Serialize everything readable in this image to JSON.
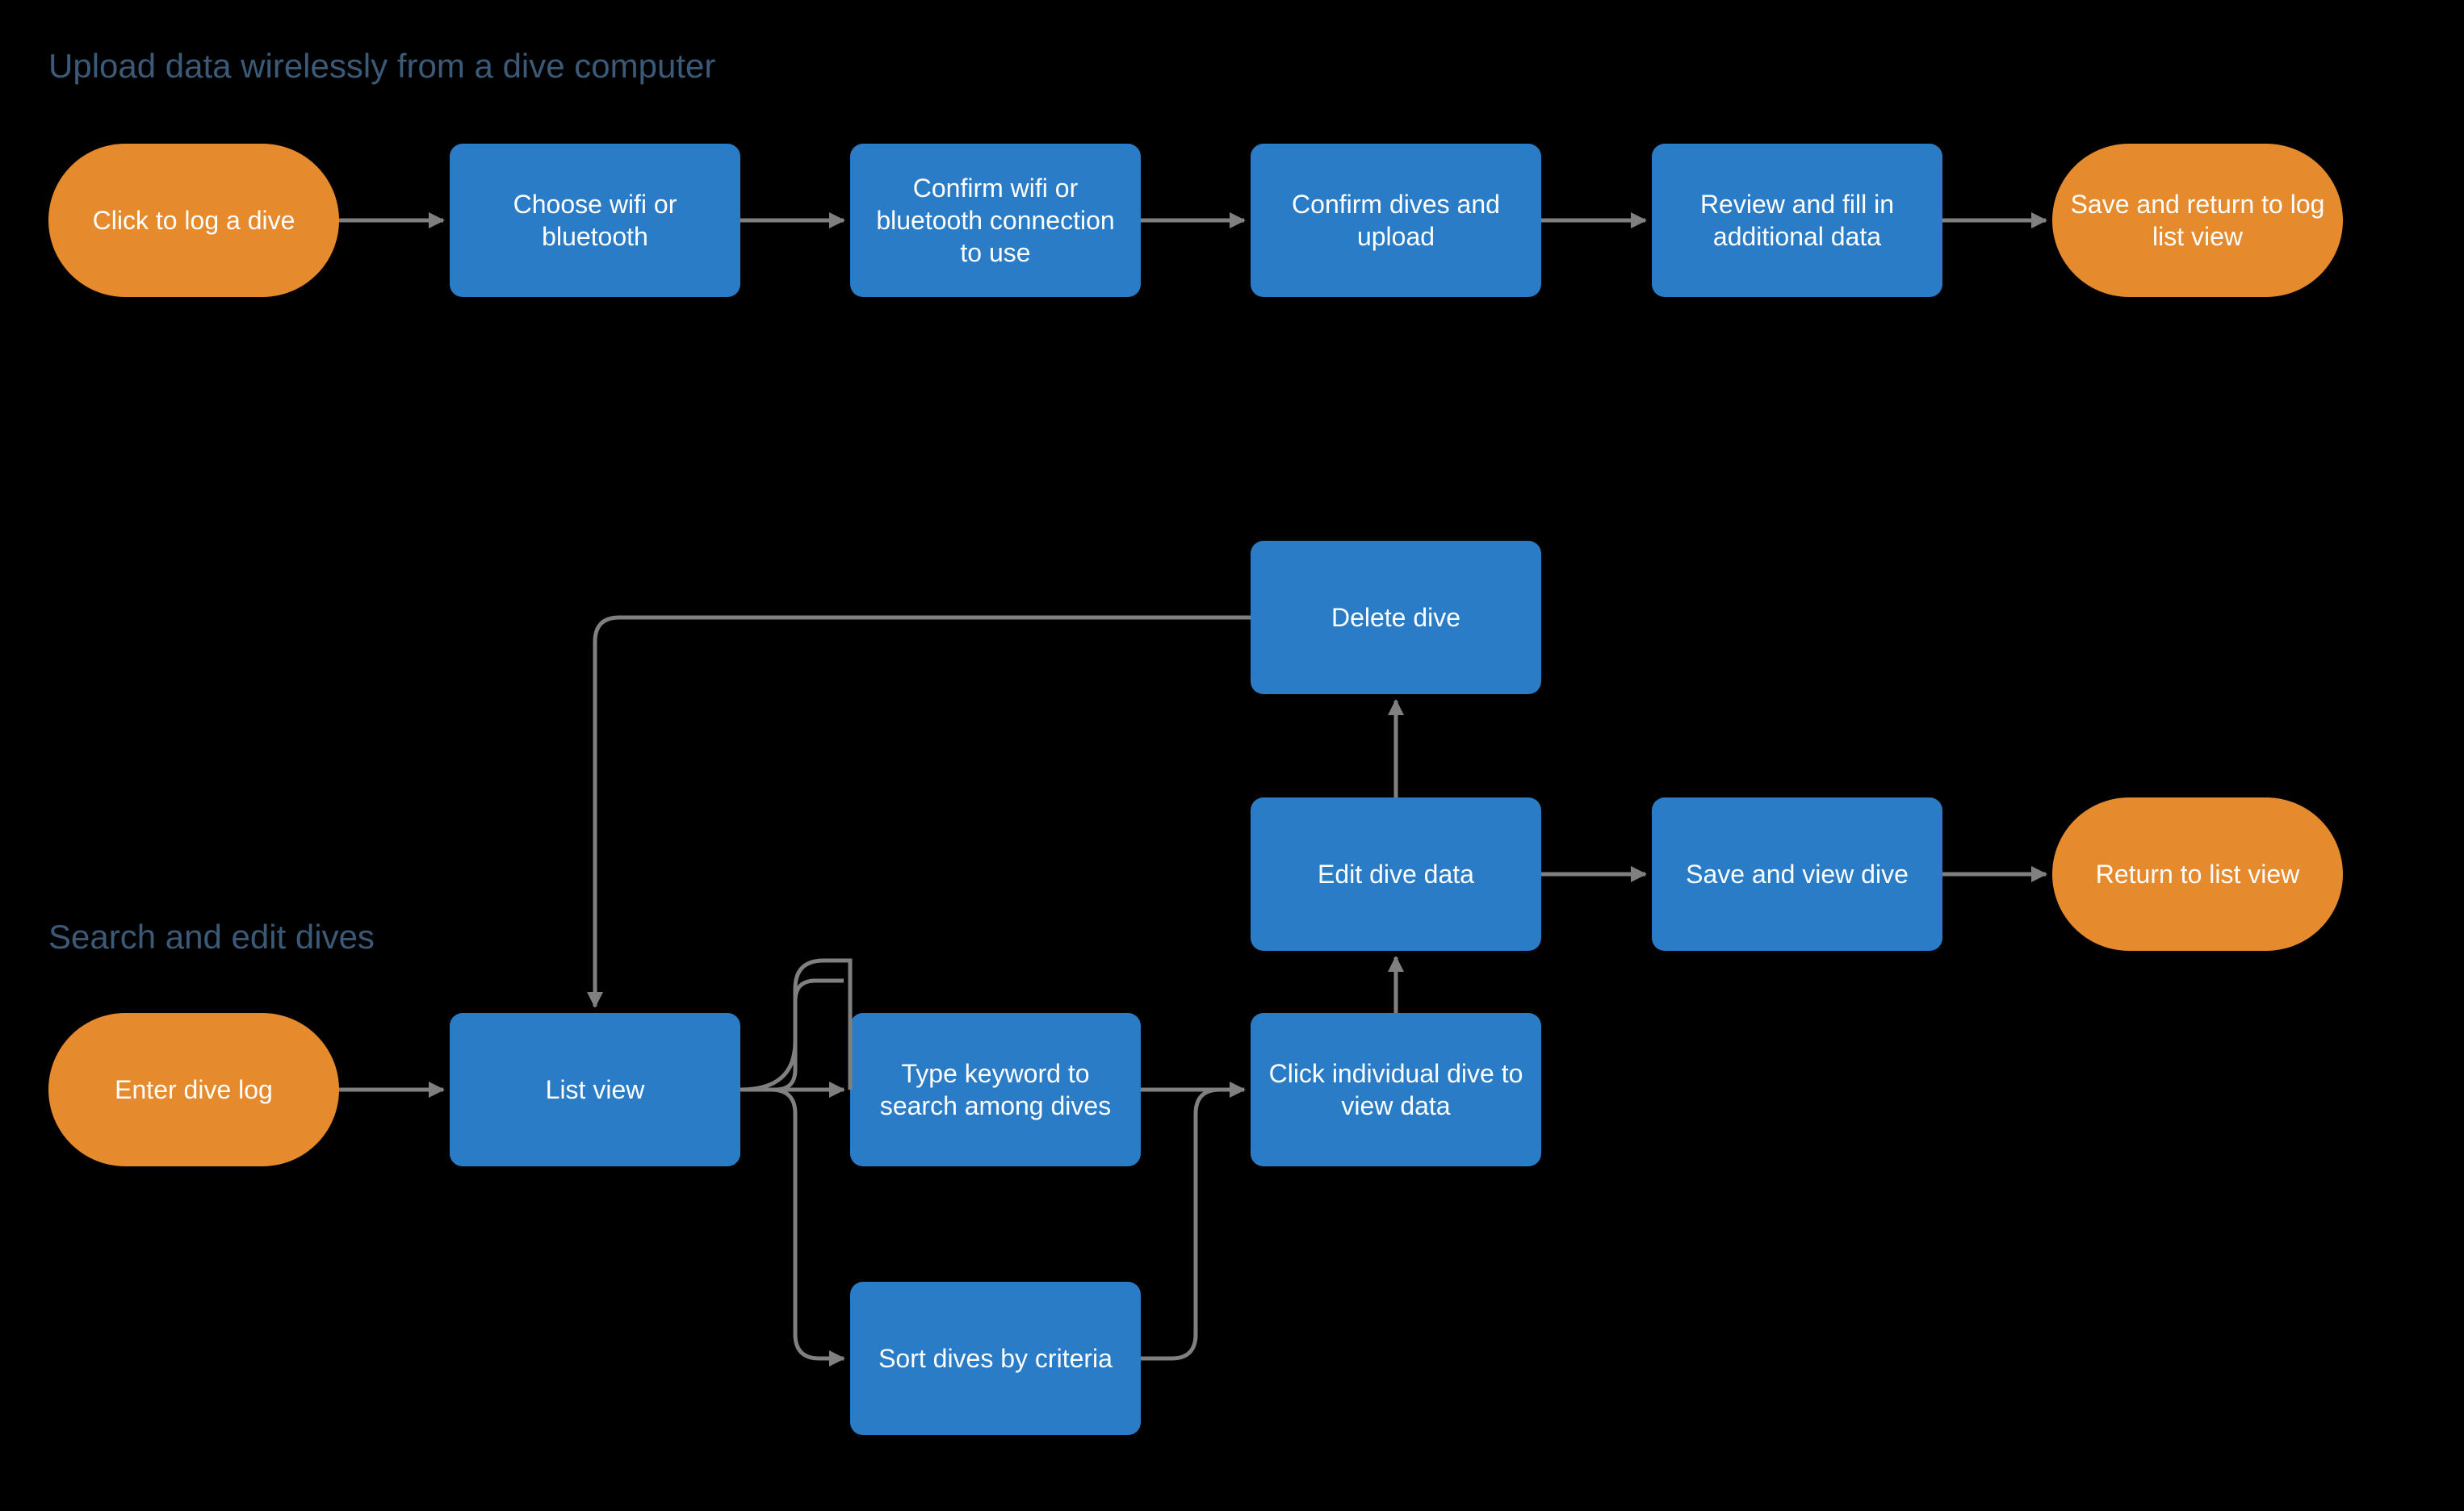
{
  "flow1": {
    "title": "Upload data wirelessly from a dive computer",
    "start": "Click to log a dive",
    "step1": "Choose wifi or bluetooth",
    "step2": "Confirm wifi or bluetooth connection to use",
    "step3": "Confirm dives and upload",
    "step4": "Review and fill in additional data",
    "end": "Save and return to log list view"
  },
  "flow2": {
    "title": "Search and edit dives",
    "start": "Enter dive log",
    "list": "List view",
    "search": "Type keyword to search among dives",
    "sort": "Sort dives by criteria",
    "view": "Click individual dive to view data",
    "edit": "Edit dive data",
    "delete": "Delete dive",
    "save": "Save and view dive",
    "end": "Return to list view"
  },
  "colors": {
    "terminal": "#e68a2e",
    "process": "#2a7cc7",
    "arrow": "#808080",
    "title": "#3a5a78",
    "bg": "#000000"
  }
}
